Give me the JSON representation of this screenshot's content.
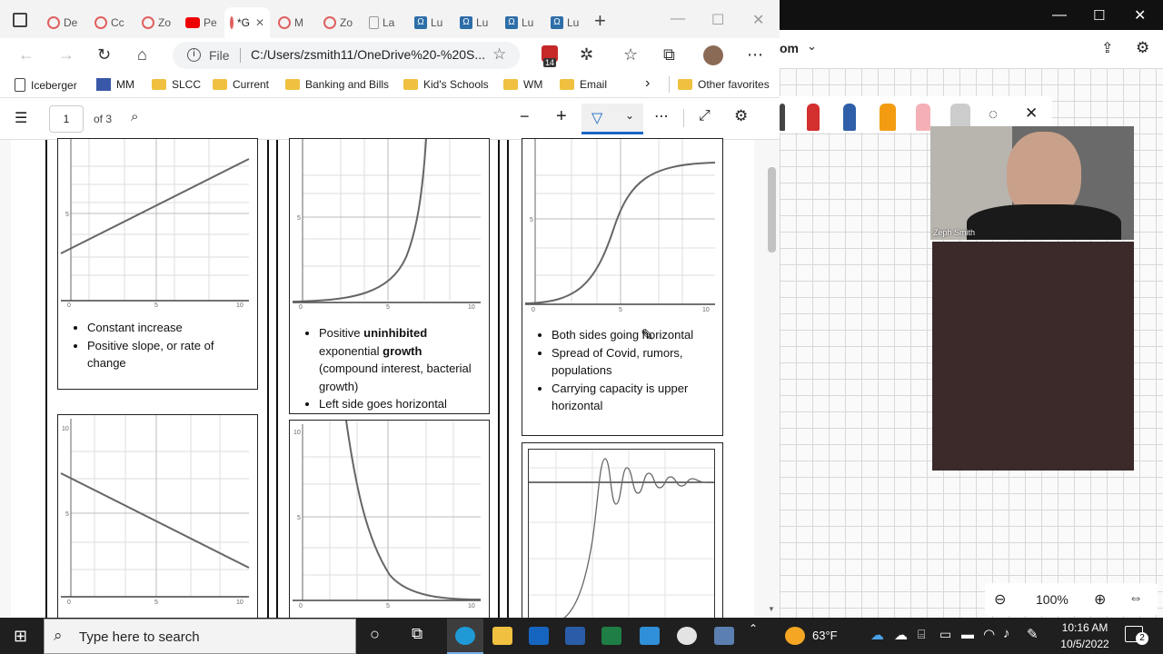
{
  "browser": {
    "tabs": [
      {
        "label": "De",
        "icon": "wheel-icon"
      },
      {
        "label": "Cc",
        "icon": "wheel-icon"
      },
      {
        "label": "Zo",
        "icon": "wheel-icon"
      },
      {
        "label": "Pe",
        "icon": "youtube-icon"
      },
      {
        "label": "*G",
        "icon": "wheel-icon",
        "active": true
      },
      {
        "label": "M",
        "icon": "wheel-icon"
      },
      {
        "label": "Zo",
        "icon": "wheel-icon"
      },
      {
        "label": "La",
        "icon": "doc-icon"
      },
      {
        "label": "Lu",
        "icon": "omega-icon"
      },
      {
        "label": "Lu",
        "icon": "omega-icon"
      },
      {
        "label": "Lu",
        "icon": "omega-icon"
      },
      {
        "label": "Lu",
        "icon": "omega-icon"
      }
    ],
    "address": {
      "scheme": "File",
      "url": "C:/Users/zsmith11/OneDrive%20-%20S..."
    },
    "badge_count": "14",
    "favorites": [
      "Iceberger",
      "MM",
      "SLCC",
      "Current",
      "Banking and Bills",
      "Kid's Schools",
      "WM",
      "Email"
    ],
    "other_favorites": "Other favorites"
  },
  "pdf": {
    "page_number": "1",
    "page_total": "of 3"
  },
  "cells": {
    "linear": [
      "Constant increase",
      "Positive slope, or rate of change"
    ],
    "exponential_1": "Positive ",
    "exponential_b1": "uninhibited",
    "exponential_2": "exponential ",
    "exponential_b2": "growth",
    "exponential_3": "(compound interest, bacterial growth)",
    "exponential_4": "Left side goes horizontal",
    "logistic": [
      "Both sides going horizontal",
      "Spread of Covid, rumors, populations",
      "Carrying capacity is upper horizontal"
    ]
  },
  "graph_ticks": {
    "five": "5",
    "ten": "10",
    "zero": "0"
  },
  "whiteboard": {
    "title_suffix": "om",
    "participant": "Zeph Smith",
    "zoom": "100%"
  },
  "taskbar": {
    "search_placeholder": "Type here to search",
    "weather": "63°F",
    "time": "10:16 AM",
    "date": "10/5/2022",
    "notifications": "2"
  }
}
